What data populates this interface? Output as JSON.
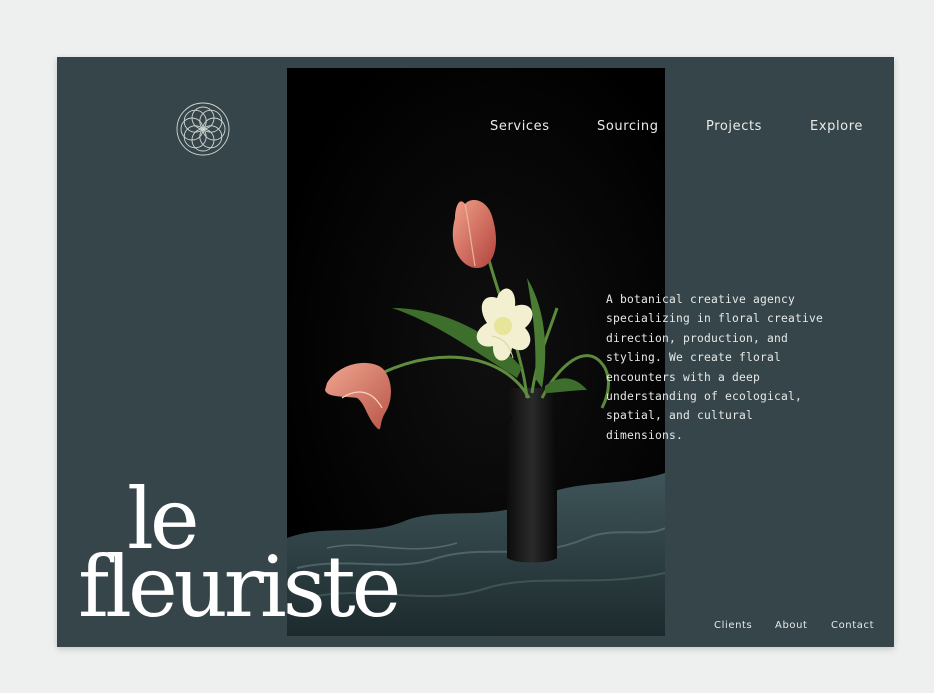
{
  "brand": {
    "logo_icon": "rosette-logo-icon",
    "wordmark_line1": "le",
    "wordmark_line2": "fleuriste"
  },
  "nav": {
    "items": [
      {
        "label": "Services"
      },
      {
        "label": "Sourcing"
      },
      {
        "label": "Projects"
      },
      {
        "label": "Explore"
      }
    ]
  },
  "hero": {
    "description": "A botanical creative agency specializing in floral creative direction, production, and styling. We create floral encounters with a deep understanding of ecological, spatial, and cultural dimensions.",
    "image": "tulips-in-dark-vase-photo"
  },
  "footer": {
    "links": [
      {
        "label": "Clients"
      },
      {
        "label": "About"
      },
      {
        "label": "Contact"
      }
    ]
  },
  "colors": {
    "background": "#36454a",
    "page": "#eef0ef",
    "text": "#e9ecea",
    "photo_bg": "#000000"
  }
}
